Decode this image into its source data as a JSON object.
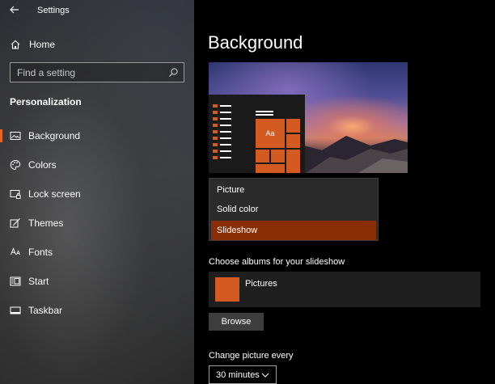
{
  "window": {
    "title": "Settings"
  },
  "sidebar": {
    "home_label": "Home",
    "search_placeholder": "Find a setting",
    "section_title": "Personalization",
    "items": [
      {
        "label": "Background",
        "icon": "picture-icon",
        "active": true
      },
      {
        "label": "Colors",
        "icon": "palette-icon",
        "active": false
      },
      {
        "label": "Lock screen",
        "icon": "lock-screen-icon",
        "active": false
      },
      {
        "label": "Themes",
        "icon": "themes-icon",
        "active": false
      },
      {
        "label": "Fonts",
        "icon": "fonts-icon",
        "active": false
      },
      {
        "label": "Start",
        "icon": "start-icon",
        "active": false
      },
      {
        "label": "Taskbar",
        "icon": "taskbar-icon",
        "active": false
      }
    ]
  },
  "main": {
    "title": "Background",
    "preview_tile_text": "Aa",
    "background_options": [
      "Picture",
      "Solid color",
      "Slideshow"
    ],
    "selected_option": "Slideshow",
    "albums_label": "Choose albums for your slideshow",
    "album_name": "Pictures",
    "browse_label": "Browse",
    "change_label": "Change picture every",
    "interval_value": "30 minutes"
  },
  "colors": {
    "accent": "#d35a21",
    "selected_option_bg": "#8a2e08",
    "active_indicator": "#e2652a"
  }
}
